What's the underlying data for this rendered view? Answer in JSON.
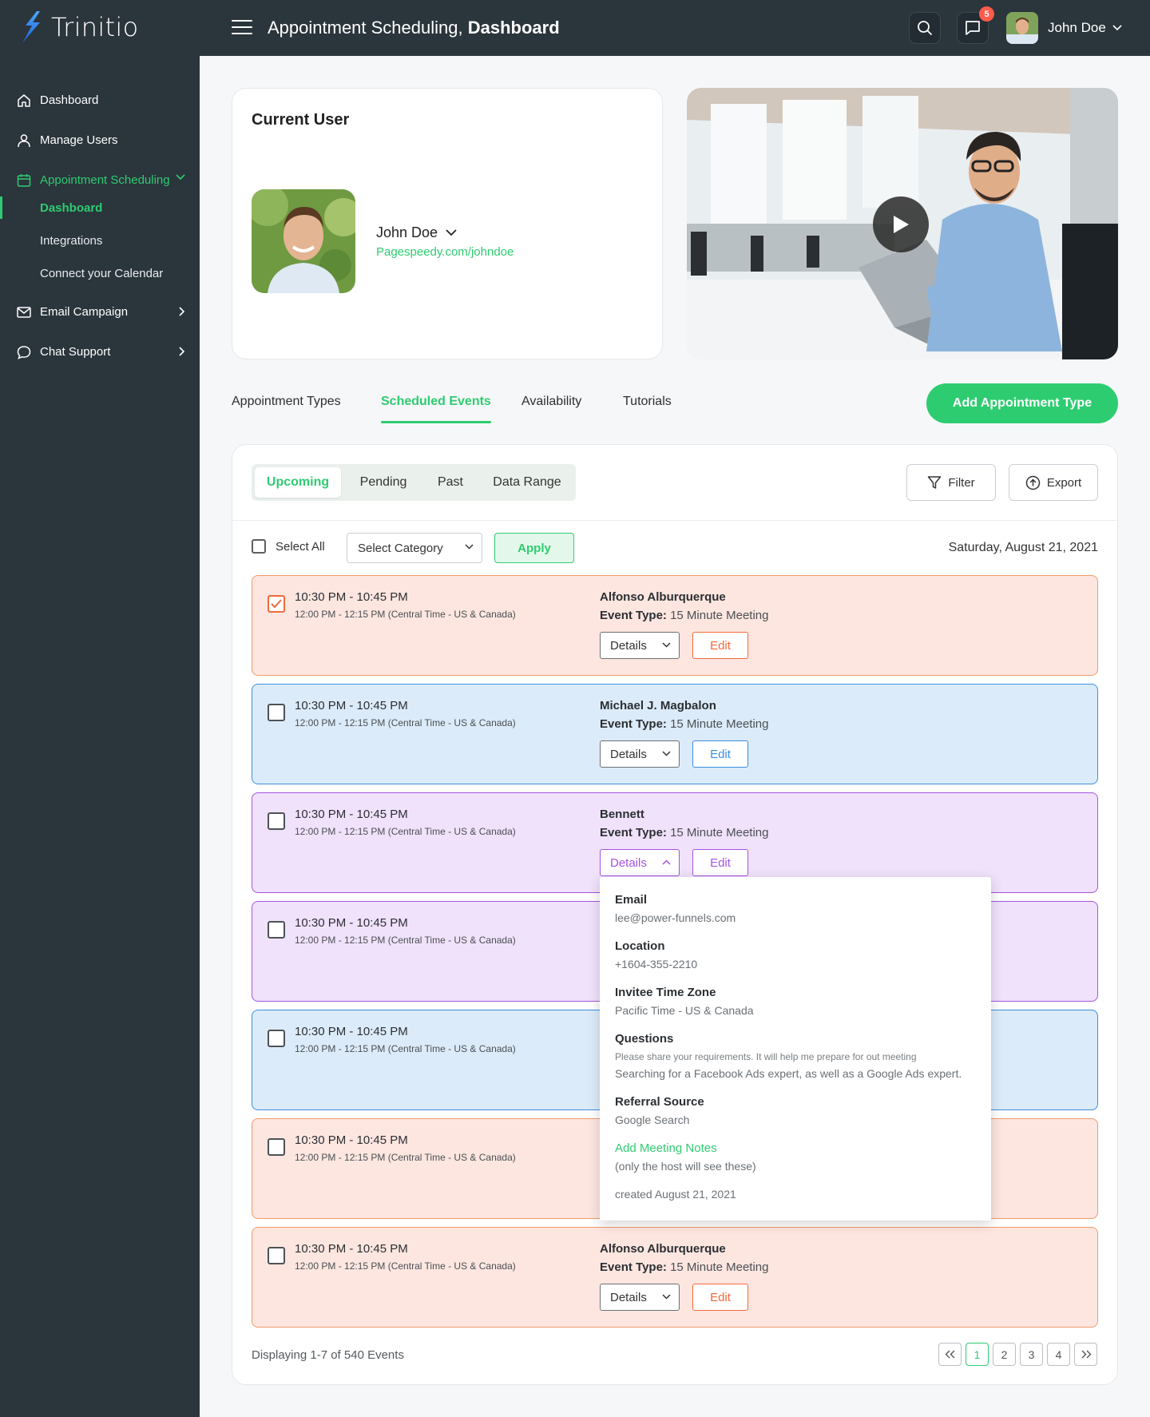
{
  "app": {
    "name": "Trinitio",
    "heading_prefix": "Appointment Scheduling, ",
    "heading_bold": "Dashboard",
    "notifications_count": "5",
    "user_name": "John Doe"
  },
  "sidebar": {
    "items": [
      {
        "label": "Dashboard"
      },
      {
        "label": "Manage Users"
      },
      {
        "label": "Appointment Scheduling"
      },
      {
        "label": "Email Campaign"
      },
      {
        "label": "Chat Support"
      }
    ],
    "sub_items": [
      {
        "label": "Dashboard"
      },
      {
        "label": "Integrations"
      },
      {
        "label": "Connect your Calendar"
      }
    ]
  },
  "current_user": {
    "title": "Current User",
    "name": "John Doe",
    "link": "Pagespeedy.com/johndoe"
  },
  "tabs": [
    {
      "label": "Appointment Types"
    },
    {
      "label": "Scheduled Events"
    },
    {
      "label": "Availability"
    },
    {
      "label": "Tutorials"
    }
  ],
  "add_button": "Add Appointment Type",
  "segments": [
    {
      "label": "Upcoming"
    },
    {
      "label": "Pending"
    },
    {
      "label": "Past"
    },
    {
      "label": "Data Range"
    }
  ],
  "toolbar": {
    "filter": "Filter",
    "export": "Export",
    "select_all": "Select All",
    "select_category": "Select Category",
    "apply": "Apply",
    "date": "Saturday, August 21, 2021"
  },
  "events": [
    {
      "time": "10:30 PM - 10:45 PM",
      "tz": "12:00 PM - 12:15 PM (Central Time - US & Canada)",
      "name": "Alfonso Alburquerque",
      "type_label": "Event Type:",
      "type": "15 Minute Meeting",
      "details": "Details",
      "edit": "Edit",
      "color": "#f06a3a",
      "checked": true
    },
    {
      "time": "10:30 PM - 10:45 PM",
      "tz": "12:00 PM - 12:15 PM (Central Time - US & Canada)",
      "name": "Michael J. Magbalon",
      "type_label": "Event Type:",
      "type": "15 Minute Meeting",
      "details": "Details",
      "edit": "Edit",
      "color": "#3a8fe0",
      "checked": false
    },
    {
      "time": "10:30 PM - 10:45 PM",
      "tz": "12:00 PM - 12:15 PM (Central Time - US & Canada)",
      "name": "Bennett",
      "type_label": "Event Type:",
      "type": "15 Minute Meeting",
      "details": "Details",
      "edit": "Edit",
      "color": "#a753e0",
      "checked": false
    },
    {
      "time": "10:30 PM - 10:45 PM",
      "tz": "12:00 PM - 12:15 PM (Central Time - US & Canada)",
      "color": "#a753e0",
      "checked": false
    },
    {
      "time": "10:30 PM - 10:45 PM",
      "tz": "12:00 PM - 12:15 PM (Central Time - US & Canada)",
      "color": "#3a8fe0",
      "checked": false
    },
    {
      "time": "10:30 PM - 10:45 PM",
      "tz": "12:00 PM - 12:15 PM (Central Time - US & Canada)",
      "color": "#f06a3a",
      "checked": false
    },
    {
      "time": "10:30 PM - 10:45 PM",
      "tz": "12:00 PM - 12:15 PM (Central Time - US & Canada)",
      "name": "Alfonso Alburquerque",
      "type_label": "Event Type:",
      "type": "15 Minute Meeting",
      "details": "Details",
      "edit": "Edit",
      "color": "#f06a3a",
      "checked": false
    }
  ],
  "details_popup": {
    "email_label": "Email",
    "email": "lee@power-funnels.com",
    "location_label": "Location",
    "location": "+1604-355-2210",
    "tz_label": "Invitee Time Zone",
    "tz": "Pacific Time - US & Canada",
    "questions_label": "Questions",
    "question": "Please share your requirements. It will help me prepare for out meeting",
    "answer": "Searching for a Facebook Ads expert, as well as a Google Ads expert.",
    "referral_label": "Referral Source",
    "referral": "Google Search",
    "notes_link": "Add Meeting Notes",
    "notes_hint": "(only the host will see these)",
    "created": "created August 21, 2021"
  },
  "footer": {
    "count": "Displaying 1-7 of 540 Events",
    "pages": [
      "1",
      "2",
      "3",
      "4"
    ],
    "current_page": "1"
  },
  "colors": {
    "accent": "#2ecc71",
    "sidebar_bg": "#2b353c",
    "orange": "#f06a3a",
    "blue": "#3a8fe0",
    "purple": "#a753e0"
  }
}
